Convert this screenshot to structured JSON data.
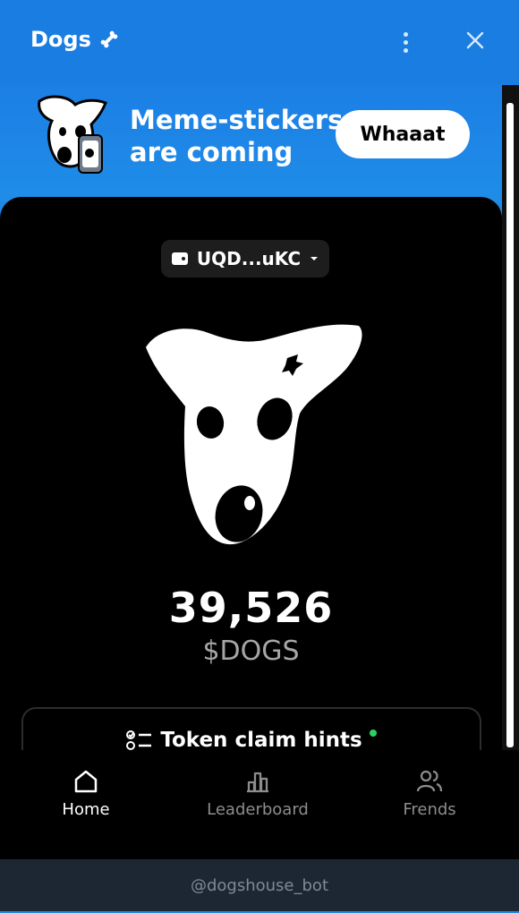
{
  "app": {
    "title": "Dogs"
  },
  "banner": {
    "line1": "Meme-stickers",
    "line2": "are coming",
    "button_label": "Whaaat"
  },
  "wallet": {
    "address": "UQD...uKC"
  },
  "balance": {
    "amount": "39,526",
    "ticker": "$DOGS"
  },
  "hints": {
    "label": "Token claim hints"
  },
  "nav": {
    "items": [
      {
        "label": "Home",
        "icon": "home-icon",
        "active": true
      },
      {
        "label": "Leaderboard",
        "icon": "leaderboard-icon",
        "active": false
      },
      {
        "label": "Frends",
        "icon": "friends-icon",
        "active": false
      }
    ]
  },
  "footer": {
    "bot_handle": "@dogshouse_bot"
  },
  "colors": {
    "header_blue": "#1a7de2",
    "background": "#000000",
    "accent_green": "#2bd364",
    "footer_bg": "#1d2733"
  }
}
